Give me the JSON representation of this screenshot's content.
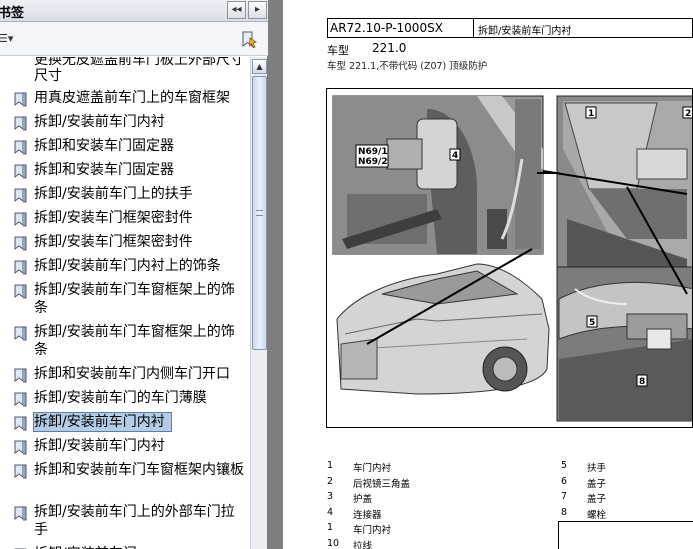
{
  "panel": {
    "title": "书签",
    "collapse_glyph": "◂◂",
    "menu_glyph": "▸",
    "options_glyph": "☰▾"
  },
  "bookmarks": [
    {
      "text": "更换无皮遮盖前车门板上外部尺寸"
    },
    {
      "text": "尺寸"
    },
    {
      "text": "用真皮遮盖前车门上的车窗框架"
    },
    {
      "text": "拆卸/安装前车门内衬"
    },
    {
      "text": "拆卸和安装车门固定器"
    },
    {
      "text": "拆卸和安装车门固定器"
    },
    {
      "text": "拆卸/安装前车门上的扶手"
    },
    {
      "text": "拆卸/安装车门框架密封件"
    },
    {
      "text": "拆卸/安装车门框架密封件"
    },
    {
      "text": "拆卸/安装前车门内衬上的饰条"
    },
    {
      "text": "拆卸/安装前车门车窗框架上的饰条"
    },
    {
      "text": "拆卸/安装前车门车窗框架上的饰条"
    },
    {
      "text": "拆卸和安装前车门内侧车门开口"
    },
    {
      "text": "拆卸/安装前车门的车门薄膜"
    },
    {
      "text": "拆卸/安装前车门内衬"
    },
    {
      "text": "拆卸/安装前车门内衬"
    },
    {
      "text": "拆卸和安装前车门车窗框架内镶板"
    },
    {
      "text": "拆卸/安装前车门上的外部车门拉手"
    },
    {
      "text": "拆卸/安装前车门"
    }
  ],
  "document": {
    "code": "AR72.10-P-1000SX",
    "title": "拆卸/安装前车门内衬",
    "model_label": "车型",
    "model_value": "221.0",
    "model_line2": "车型   221.1,不带代码 (Z07) 顶级防护",
    "figure_labels": [
      "N69/1",
      "N69/2",
      "4",
      "1",
      "2",
      "5",
      "8"
    ],
    "legend_left": [
      {
        "num": "1",
        "text": "车门内衬"
      },
      {
        "num": "2",
        "text": "后视镜三角盖"
      },
      {
        "num": "3",
        "text": "护盖"
      },
      {
        "num": "4",
        "text": "连接器"
      },
      {
        "num": "1",
        "text": "车门内衬"
      },
      {
        "num": "10",
        "text": "拉线"
      }
    ],
    "legend_right": [
      {
        "num": "5",
        "text": "扶手"
      },
      {
        "num": "6",
        "text": "盖子"
      },
      {
        "num": "7",
        "text": "盖子"
      },
      {
        "num": "8",
        "text": "螺栓"
      }
    ]
  }
}
